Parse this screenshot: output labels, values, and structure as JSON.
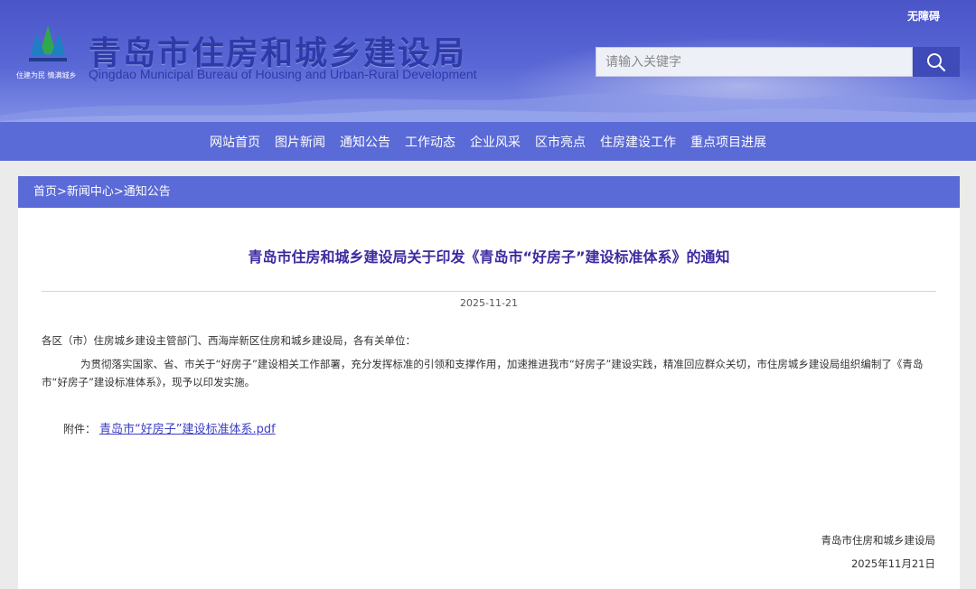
{
  "header": {
    "title": "青岛市住房和城乡建设局",
    "subtitle": "Qingdao Municipal Bureau of Housing and Urban-Rural Development",
    "logo_slogan": "住建为民 情满城乡",
    "accessibility_label": "无障碍",
    "search": {
      "placeholder": "请输入关键字"
    }
  },
  "nav": {
    "items": [
      {
        "label": "网站首页"
      },
      {
        "label": "图片新闻"
      },
      {
        "label": "通知公告"
      },
      {
        "label": "工作动态"
      },
      {
        "label": "企业风采"
      },
      {
        "label": "区市亮点"
      },
      {
        "label": "住房建设工作"
      },
      {
        "label": "重点项目进展"
      }
    ]
  },
  "breadcrumb": {
    "text": "首页>新闻中心>通知公告"
  },
  "article": {
    "title": "青岛市住房和城乡建设局关于印发《青岛市“好房子”建设标准体系》的通知",
    "date": "2025-11-21",
    "salutation": "各区（市）住房城乡建设主管部门、西海岸新区住房和城乡建设局，各有关单位：",
    "body": "为贯彻落实国家、省、市关于“好房子”建设相关工作部署，充分发挥标准的引领和支撑作用，加速推进我市“好房子”建设实践，精准回应群众关切，市住房城乡建设局组织编制了《青岛市“好房子”建设标准体系》，现予以印发实施。",
    "attachment_label": "附件：",
    "attachment_link": "青岛市“好房子”建设标准体系.pdf",
    "sign_org": "青岛市住房和城乡建设局",
    "sign_date": "2025年11月21日"
  },
  "colors": {
    "banner": "#4a55c8",
    "nav": "#5a6ad6",
    "title": "#3d2aa0",
    "link": "#3c3fc2"
  }
}
